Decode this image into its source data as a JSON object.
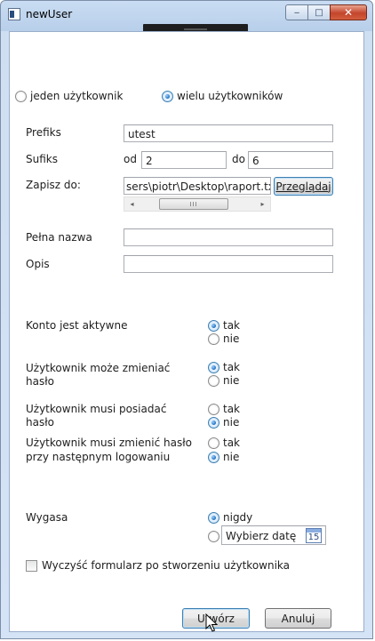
{
  "window": {
    "title": "newUser",
    "buttons": {
      "minimize": "‒",
      "maximize": "□",
      "close": "✕"
    }
  },
  "mode": {
    "options": [
      "jeden użytkownik",
      "wielu użytkowników"
    ],
    "selected": "wielu użytkowników"
  },
  "fields": {
    "prefix_label": "Prefiks",
    "prefix_value": "utest",
    "suffix_label": "Sufiks",
    "suffix_from_label": "od",
    "suffix_from_value": "2",
    "suffix_to_label": "do",
    "suffix_to_value": "6",
    "save_label": "Zapisz do:",
    "save_path": "sers\\piotr\\Desktop\\raport.txt",
    "browse_button": "Przeglądaj",
    "scroll_left": "◂",
    "scroll_right": "▸",
    "scroll_thumb_grip": "III",
    "full_name_label": "Pełna nazwa",
    "full_name_value": "",
    "description_label": "Opis",
    "description_value": ""
  },
  "options": [
    {
      "label": "Konto jest aktywne",
      "yes": "tak",
      "no": "nie",
      "selected": "tak"
    },
    {
      "label_line1": "Użytkownik może zmieniać",
      "label_line2": "hasło",
      "yes": "tak",
      "no": "nie",
      "selected": "tak"
    },
    {
      "label_line1": "Użytkownik musi posiadać",
      "label_line2": "hasło",
      "yes": "tak",
      "no": "nie",
      "selected": "nie"
    },
    {
      "label_line1": "Użytkownik musi zmienić hasło",
      "label_line2": "przy następnym logowaniu",
      "yes": "tak",
      "no": "nie",
      "selected": "nie"
    }
  ],
  "expires": {
    "label": "Wygasa",
    "never": "nigdy",
    "date_placeholder": "Wybierz datę",
    "calendar_day": "15",
    "selected": "nigdy"
  },
  "clear_form": {
    "label": "Wyczyść formularz po stworzeniu użytkownika",
    "checked": false
  },
  "actions": {
    "create": "Utwórz",
    "cancel": "Anuluj"
  },
  "colors": {
    "titlebar": "#c9dcf2",
    "close_button": "#c4452c",
    "radio_selected": "#1d6dbf"
  }
}
